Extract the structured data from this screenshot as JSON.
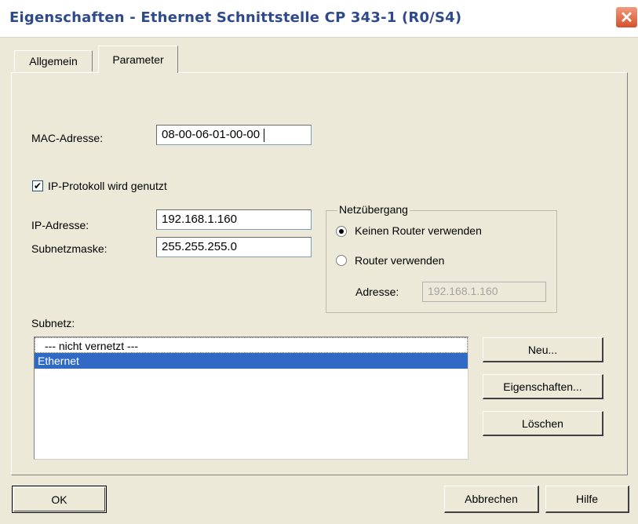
{
  "window": {
    "title": "Eigenschaften - Ethernet Schnittstelle  CP 343-1 (R0/S4)",
    "close_glyph": "✕"
  },
  "tabs": [
    {
      "label": "Allgemein",
      "active": false
    },
    {
      "label": "Parameter",
      "active": true
    }
  ],
  "mac": {
    "label": "MAC-Adresse:",
    "value": "08-00-06-01-00-00"
  },
  "ip_protocol": {
    "label": "IP-Protokoll wird genutzt",
    "checked": true,
    "check_glyph": "✔"
  },
  "ip_address": {
    "label": "IP-Adresse:",
    "value": "192.168.1.160"
  },
  "subnet_mask": {
    "label": "Subnetzmaske:",
    "value": "255.255.255.0"
  },
  "gateway": {
    "legend": "Netzübergang",
    "options": [
      {
        "label": "Keinen Router verwenden",
        "checked": true
      },
      {
        "label": "Router verwenden",
        "checked": false
      }
    ],
    "address_label": "Adresse:",
    "address_value": "192.168.1.160"
  },
  "subnet": {
    "label": "Subnetz:",
    "items": [
      {
        "label": "--- nicht vernetzt ---",
        "selected": false
      },
      {
        "label": "Ethernet",
        "selected": true
      }
    ],
    "buttons": {
      "new": "Neu...",
      "properties": "Eigenschaften...",
      "delete": "Löschen"
    }
  },
  "footer": {
    "ok": "OK",
    "cancel": "Abbrechen",
    "help": "Hilfe"
  },
  "colors": {
    "title": "#2f4a8a",
    "selection": "#316ac5",
    "close": "#d5502b",
    "dialog_bg": "#ece9d8"
  },
  "icons": {
    "close": "close-icon",
    "check": "check-icon"
  }
}
